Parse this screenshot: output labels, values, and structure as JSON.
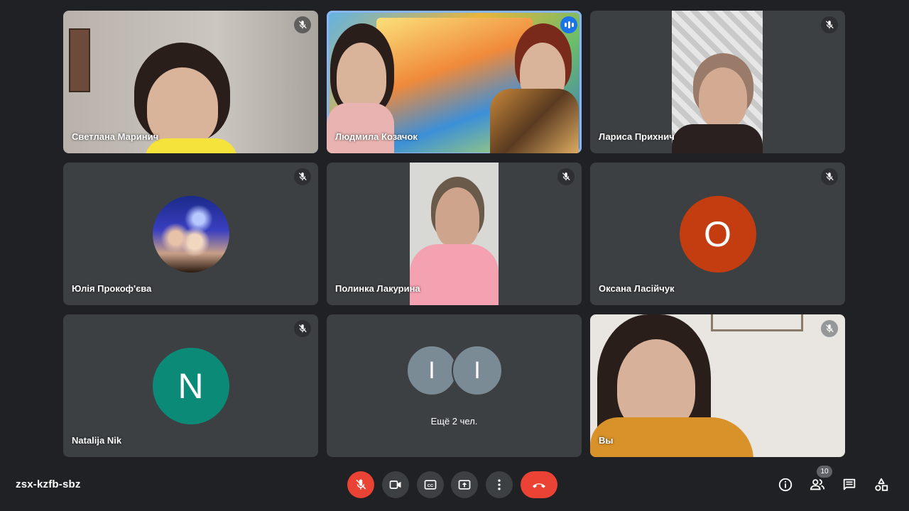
{
  "meeting": {
    "code": "zsx-kzfb-sbz"
  },
  "participants": {
    "p1": {
      "name": "Светлана Маринич",
      "muted": true
    },
    "p2": {
      "name": "Людмила Козачок",
      "speaking": true
    },
    "p3": {
      "name": "Лариса Прихнич",
      "muted": true
    },
    "p4": {
      "name": "Юлія Прокоф'єва",
      "muted": true
    },
    "p5": {
      "name": "Полинка Лакурина",
      "muted": true
    },
    "p6": {
      "name": "Оксана Ласійчук",
      "muted": true,
      "initial": "О",
      "color": "#c43d10"
    },
    "p7": {
      "name": "Natalija Nik",
      "muted": true,
      "initial": "N",
      "color": "#0b8a78"
    },
    "p8": {
      "label": "Ещё 2 чел.",
      "initials": [
        "I",
        "I"
      ]
    },
    "p9": {
      "name": "Вы",
      "muted": true
    }
  },
  "toolbar": {
    "participant_count": "10"
  },
  "colors": {
    "background": "#202124",
    "tile": "#3c4043",
    "end_call": "#ea4335",
    "active_border": "#8ab4f8"
  }
}
